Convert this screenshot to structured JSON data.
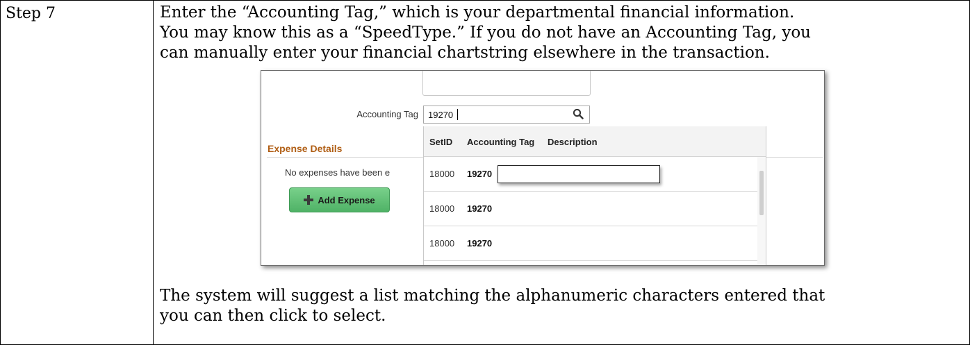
{
  "document": {
    "step_label": "Step 7",
    "instruction_lines": [
      "Enter the “Accounting Tag,” which is your departmental financial information.",
      "You may know this as a “SpeedType.” If you do not have an Accounting Tag, you",
      "can manually enter your financial chartstring elsewhere in the transaction."
    ],
    "note_lines": [
      "The system will suggest a list matching the alphanumeric characters entered that",
      "you can then click to select."
    ]
  },
  "screenshot": {
    "field_label": "Accounting Tag",
    "field_value": "19270",
    "search_icon": "search-icon",
    "section_title": "Expense Details",
    "section_title_color": "#b05e14",
    "empty_message": "No expenses have been e",
    "add_button_label": "Add Expense",
    "add_button_color": "#4fb266",
    "dropdown": {
      "columns": [
        "SetID",
        "Accounting Tag",
        "Description"
      ],
      "rows": [
        {
          "setid": "18000",
          "tag": "19270"
        },
        {
          "setid": "18000",
          "tag": "19270"
        },
        {
          "setid": "18000",
          "tag": "19270"
        }
      ]
    }
  }
}
